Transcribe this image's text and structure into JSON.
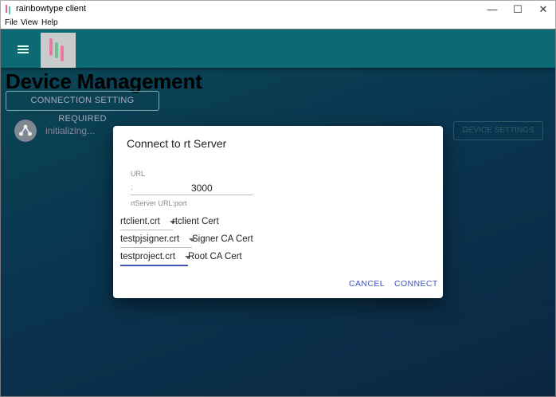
{
  "window": {
    "title": "rainbowtype client",
    "minimize_glyph": "—",
    "maximize_glyph": "☐",
    "close_glyph": "✕"
  },
  "menu": {
    "file": "File",
    "view": "View",
    "help": "Help"
  },
  "appbar": {
    "menu_icon": "hamburger-icon",
    "logo_icon": "rainbowtype-logo"
  },
  "page": {
    "title": "Device Management",
    "connection_button": "CONNECTION SETTING REQUIRED",
    "device_status": "initializing...",
    "device_settings_button": "DEVICE SETTINGS"
  },
  "dialog": {
    "title": "Connect to rt Server",
    "url_label": "URL",
    "url_prefix": ":",
    "url_value": "3000",
    "url_helper": "rtServer URL:port",
    "selects": [
      {
        "value": "rtclient.crt",
        "description": "rtclient Cert"
      },
      {
        "value": "testpjsigner.crt",
        "description": "Signer CA Cert"
      },
      {
        "value": "testproject.crt",
        "description": "Root CA Cert"
      }
    ],
    "cancel_label": "CANCEL",
    "connect_label": "CONNECT"
  },
  "colors": {
    "appbar": "#0d6a74",
    "accent": "#3f51b5",
    "background_dark": "#0b2742"
  }
}
